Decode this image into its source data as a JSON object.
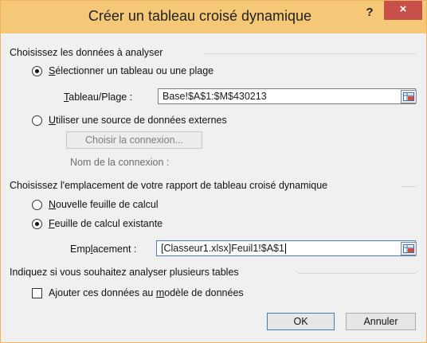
{
  "window": {
    "title": "Créer un tableau croisé dynamique",
    "help_glyph": "?",
    "close_glyph": "×"
  },
  "data_section": {
    "heading": "Choisissez les données à analyser",
    "option_table": {
      "label_key": "S",
      "label_rest": "électionner un tableau ou une plage",
      "selected": true
    },
    "range_label_key": "T",
    "range_label_rest": "ableau/Plage :",
    "range_value": "Base!$A$1:$M$430213",
    "option_external": {
      "label_key": "U",
      "label_rest": "tiliser une source de données externes",
      "selected": false
    },
    "choose_connection_label": "Choisir la connexion...",
    "connection_name_label": "Nom de la connexion :"
  },
  "location_section": {
    "heading": "Choisissez l'emplacement de votre rapport de tableau croisé dynamique",
    "option_new": {
      "label_key": "N",
      "label_rest": "ouvelle feuille de calcul",
      "selected": false
    },
    "option_existing": {
      "label_key": "F",
      "label_rest": "euille de calcul existante",
      "selected": true
    },
    "location_label_pre": "Emp",
    "location_label_key": "l",
    "location_label_rest": "acement :",
    "location_value": "[Classeur1.xlsx]Feuil1!$A$1"
  },
  "tables_section": {
    "heading": "Indiquez si vous souhaitez analyser plusieurs tables",
    "checkbox_pre": "Ajouter ces données au ",
    "checkbox_key": "m",
    "checkbox_rest": "odèle de données",
    "checked": false
  },
  "buttons": {
    "ok": "OK",
    "cancel": "Annuler"
  },
  "icons": {
    "range_picker": "range-selector-icon"
  }
}
